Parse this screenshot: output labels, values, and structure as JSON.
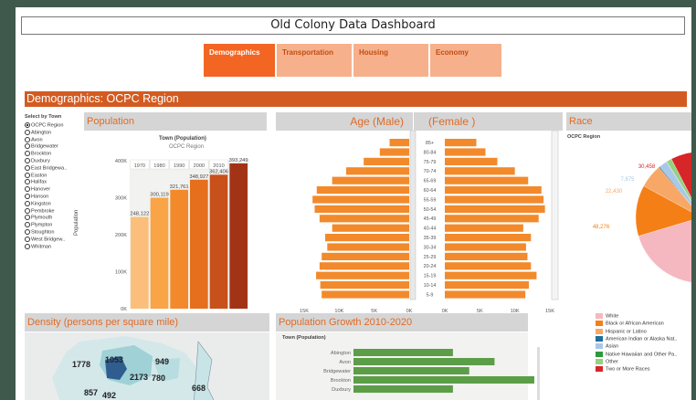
{
  "dashboard_title": "Old Colony Data Dashboard",
  "tabs": [
    {
      "label": "Demographics",
      "active": true
    },
    {
      "label": "Transportation",
      "active": false
    },
    {
      "label": "Housing",
      "active": false
    },
    {
      "label": "Economy",
      "active": false
    }
  ],
  "section_title": "Demographics: OCPC Region",
  "town_selector": {
    "label": "Select by Town",
    "options": [
      "OCPC Region",
      "Abington",
      "Avon",
      "Bridgewater",
      "Brockton",
      "Duxbury",
      "East Bridgewa..",
      "Easton",
      "Halifax",
      "Hanover",
      "Hanson",
      "Kingston",
      "Pembroke",
      "Plymouth",
      "Plympton",
      "Stoughton",
      "West Bridgew..",
      "Whitman"
    ],
    "selected": "OCPC Region"
  },
  "population_panel": {
    "title": "Population",
    "header": "Town (Population)",
    "subheader": "OCPC Region",
    "ylabel": "Population"
  },
  "age_panel": {
    "male_title": "Age (Male)",
    "female_title": "(Female )"
  },
  "race_panel": {
    "title": "Race",
    "subtitle": "OCPC Region"
  },
  "density_panel": {
    "title": "Density (persons per square mile)",
    "labels": [
      "1778",
      "1053",
      "949",
      "2173",
      "780",
      "668",
      "857",
      "492"
    ]
  },
  "growth_panel": {
    "title": "Population Growth 2010-2020",
    "header": "Town (Population)",
    "towns": [
      "Abington",
      "Avon",
      "Bridgewater",
      "Brockton",
      "Duxbury"
    ],
    "values": [
      0.55,
      0.78,
      0.64,
      1.0,
      0.55
    ]
  },
  "chart_data": [
    {
      "type": "bar",
      "title": "Population",
      "categories": [
        "1970",
        "1980",
        "1990",
        "2000",
        "2010",
        "2020"
      ],
      "values": [
        248122,
        300119,
        321761,
        348927,
        362406,
        393249
      ],
      "value_labels": [
        "248,122",
        "300,119",
        "321,761",
        "348,927",
        "362,406",
        "393,249"
      ],
      "ylabel": "Population",
      "ylim": [
        0,
        420000
      ],
      "yticks": [
        "0K",
        "100K",
        "200K",
        "300K",
        "400K"
      ],
      "colors": [
        "#fbbf7b",
        "#f9a446",
        "#f28a2c",
        "#e56f1c",
        "#c8501a",
        "#a33317"
      ]
    },
    {
      "type": "bar",
      "title": "Age",
      "categories": [
        "85+",
        "80-84",
        "75-79",
        "70-74",
        "65-69",
        "60-64",
        "55-59",
        "50-54",
        "45-49",
        "40-44",
        "35-39",
        "30-34",
        "25-29",
        "20-24",
        "15-19",
        "10-14",
        "5-9"
      ],
      "male": [
        2800,
        4200,
        6500,
        9000,
        11000,
        13200,
        13800,
        13500,
        12800,
        11000,
        12000,
        11700,
        12500,
        12800,
        13300,
        12700,
        12500
      ],
      "female": [
        4500,
        5800,
        7500,
        10000,
        11900,
        13800,
        14100,
        14300,
        13400,
        11200,
        12300,
        11600,
        11800,
        12300,
        13100,
        12000,
        11500
      ],
      "xticks": [
        "15K",
        "10K",
        "5K",
        "0K"
      ]
    },
    {
      "type": "pie",
      "title": "Race",
      "labels": [
        "White",
        "Black or African American",
        "Hispanic or Latino",
        "American Indian or Alaska Nat..",
        "Asian",
        "Native Hawaiian and Other Pa..",
        "Other",
        "Two or More Races"
      ],
      "values": [
        270000,
        48276,
        22430,
        1000,
        7875,
        300,
        5000,
        30458
      ],
      "value_labels": [
        "48,276",
        "22,430",
        "7,875",
        "30,458"
      ],
      "colors": [
        "#f5b8c0",
        "#f57f17",
        "#f7a867",
        "#1f6e9e",
        "#a9c8e8",
        "#2e9a3c",
        "#95d17f",
        "#d62627"
      ]
    }
  ]
}
